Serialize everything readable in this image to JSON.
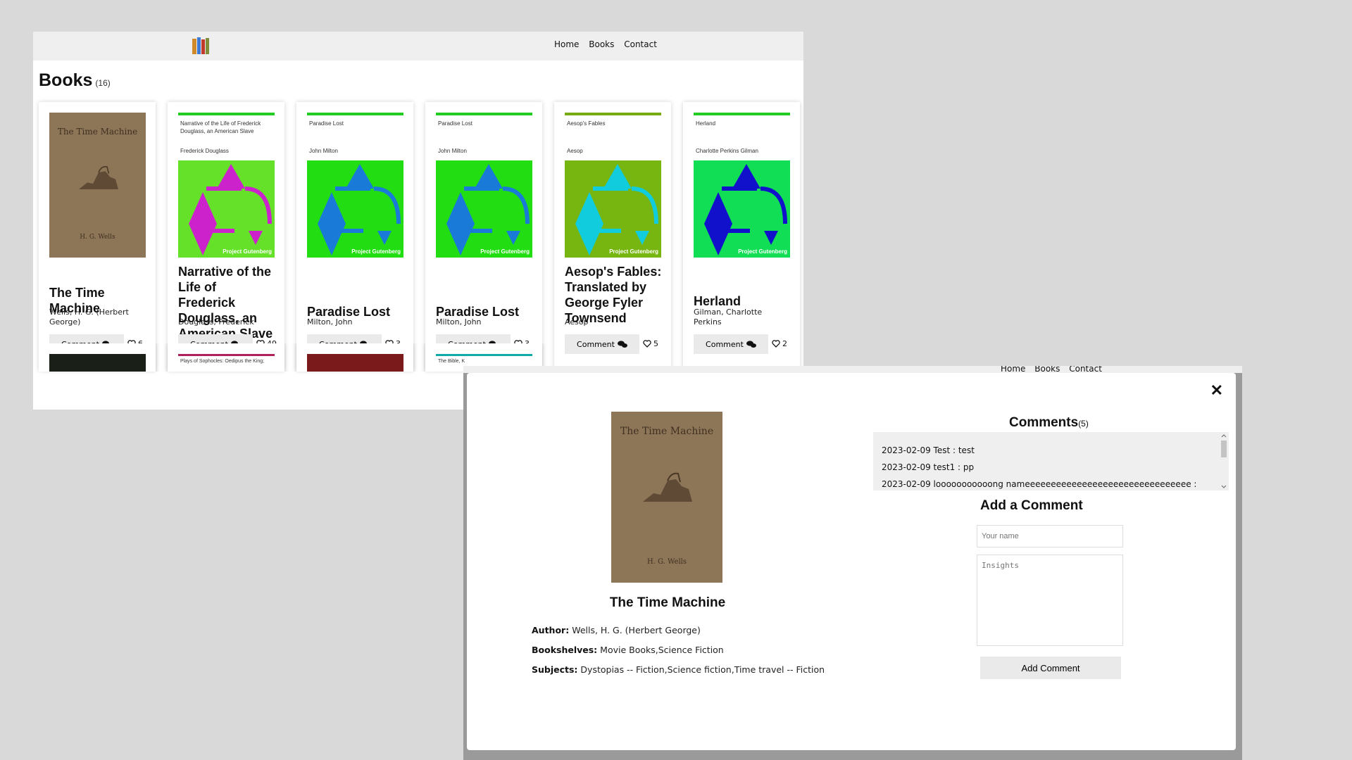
{
  "nav": {
    "home": "Home",
    "books": "Books",
    "contact": "Contact"
  },
  "page": {
    "title": "Books",
    "count": "(16)"
  },
  "books": [
    {
      "title": "The Time Machine",
      "author": "Wells, H. G. (Herbert George)",
      "comment_label": "Comment",
      "likes": "6",
      "cover": {
        "type": "photo",
        "title": "The Time Machine",
        "author": "H. G. Wells"
      }
    },
    {
      "title": "Narrative of the Life of Frederick Douglass, an American Slave",
      "author": "Douglass, Frederick",
      "comment_label": "Comment",
      "likes": "49",
      "cover": {
        "type": "gutenberg",
        "title": "Narrative of the Life of Frederick Douglass, an American Slave",
        "author": "Frederick Douglass",
        "tag": "Project Gutenberg",
        "bar": "#22cc22",
        "bg": "#66e12a",
        "accent": "#cc22cc"
      }
    },
    {
      "title": "Paradise Lost",
      "author": "Milton, John",
      "comment_label": "Comment",
      "likes": "3",
      "cover": {
        "type": "gutenberg",
        "title": "Paradise Lost",
        "author": "John Milton",
        "tag": "Project Gutenberg",
        "bar": "#22cc22",
        "bg": "#22dd11",
        "accent": "#1a7ad8"
      }
    },
    {
      "title": "Paradise Lost",
      "author": "Milton, John",
      "comment_label": "Comment",
      "likes": "3",
      "cover": {
        "type": "gutenberg",
        "title": "Paradise Lost",
        "author": "John Milton",
        "tag": "Project Gutenberg",
        "bar": "#22cc22",
        "bg": "#22dd11",
        "accent": "#1a7ad8"
      }
    },
    {
      "title": "Aesop's Fables: Translated by George Fyler Townsend",
      "author": "Aesop",
      "comment_label": "Comment",
      "likes": "5",
      "cover": {
        "type": "gutenberg",
        "title": "Aesop's Fables",
        "author": "Aesop",
        "tag": "Project Gutenberg",
        "bar": "#77aa11",
        "bg": "#77b511",
        "accent": "#11ccdd"
      }
    },
    {
      "title": "Herland",
      "author": "Gilman, Charlotte Perkins",
      "comment_label": "Comment",
      "likes": "2",
      "cover": {
        "type": "gutenberg",
        "title": "Herland",
        "author": "Charlotte Perkins Gilman",
        "tag": "Project Gutenberg",
        "bar": "#22cc22",
        "bg": "#11dd55",
        "accent": "#1111cc"
      }
    }
  ],
  "row2_snippets": [
    "Plays of Sophocles: Oedipus the King;",
    "The Bible, K"
  ],
  "modal": {
    "close": "✕",
    "book_title": "The Time Machine",
    "cover_title": "The Time Machine",
    "cover_author": "H. G. Wells",
    "author_label": "Author:",
    "author": "Wells, H. G. (Herbert George)",
    "bookshelves_label": "Bookshelves:",
    "bookshelves": "Movie Books,Science Fiction",
    "subjects_label": "Subjects:",
    "subjects": "Dystopias -- Fiction,Science fiction,Time travel -- Fiction",
    "comments_title": "Comments",
    "comments_count": "(5)",
    "comments": [
      "2023-02-09 Test : test",
      "2023-02-09 test1 : pp",
      "2023-02-09 looooooooooong nameeeeeeeeeeeeeeeeeeeeeeeeeeeeeeee :"
    ],
    "add_title": "Add a Comment",
    "name_placeholder": "Your name",
    "insights_placeholder": "Insights",
    "add_button": "Add Comment"
  },
  "colors": {
    "nav_bg": "#efefef",
    "button_bg": "#eaeaea",
    "page_bg": "#d9d9d9"
  }
}
